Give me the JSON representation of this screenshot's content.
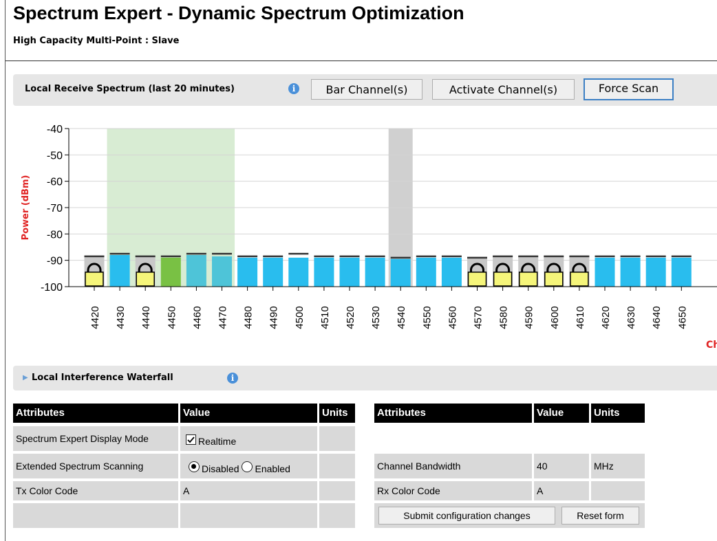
{
  "page": {
    "title": "Spectrum Expert - Dynamic Spectrum Optimization",
    "subtitle": "High Capacity Multi-Point : Slave"
  },
  "spectrum": {
    "title": "Local Receive Spectrum (last 20 minutes)",
    "info_icon": "i",
    "bar_button": "Bar Channel(s)",
    "activate_button": "Activate Channel(s)",
    "scan_button": "Force Scan",
    "axis_cut_label": "Ch"
  },
  "colors": {
    "available": "#29bdee",
    "active": "#79c144",
    "barred": "#f5f57a",
    "peak": "#c8c8c8",
    "active_band": "#d8ecd3",
    "scan_band": "#d0d0d0",
    "ylabel": "#e02424"
  },
  "chart_data": {
    "type": "bar",
    "ylabel": "Power (dBm)",
    "ylim": [
      -100,
      -40
    ],
    "yticks": [
      -40,
      -50,
      -60,
      -70,
      -80,
      -90,
      -100
    ],
    "grid": true,
    "categories": [
      "4420",
      "4430",
      "4440",
      "4450",
      "4460",
      "4470",
      "4480",
      "4490",
      "4500",
      "4510",
      "4520",
      "4530",
      "4540",
      "4550",
      "4560",
      "4570",
      "4580",
      "4590",
      "4600",
      "4610",
      "4620",
      "4630",
      "4640",
      "4650"
    ],
    "series": [
      {
        "values": [
          -94.5,
          -88,
          -94.5,
          -89,
          -88,
          -88.5,
          -89,
          -89,
          -89,
          -89,
          -89,
          -89,
          -89.5,
          -89,
          -89,
          -94.5,
          -94.5,
          -94.5,
          -94.5,
          -94.5,
          -89,
          -89,
          -89,
          -89
        ]
      }
    ],
    "peak": [
      -88.5,
      -87.5,
      -88.5,
      -88.5,
      -87.5,
      -87.5,
      -88.5,
      -88.5,
      -87.5,
      -88.5,
      -88.5,
      -88.5,
      -89,
      -88.5,
      -88.5,
      -89,
      -88.5,
      -88.5,
      -88.5,
      -88.5,
      -88.5,
      -88.5,
      -88.5,
      -88.5
    ],
    "state": [
      "barred",
      "available",
      "barred",
      "active",
      "active",
      "active",
      "available",
      "available",
      "available",
      "available",
      "available",
      "available",
      "available",
      "available",
      "available",
      "barred",
      "barred",
      "barred",
      "barred",
      "barred",
      "available",
      "available",
      "available",
      "available"
    ],
    "active_band": [
      "4430",
      "4470"
    ],
    "scan_band": [
      "4540"
    ]
  },
  "waterfall": {
    "title": "Local Interference Waterfall",
    "info_icon": "i",
    "arrow": "▶"
  },
  "left_table": {
    "headers": [
      "Attributes",
      "Value",
      "Units"
    ],
    "rows": [
      {
        "attr": "Spectrum Expert Display Mode",
        "value": "Realtime",
        "units": ""
      },
      {
        "attr": "Extended Spectrum Scanning",
        "opt1": "Disabled",
        "opt2": "Enabled",
        "units": ""
      },
      {
        "attr": "Tx Color Code",
        "value": "A",
        "units": ""
      },
      {
        "attr": "",
        "value": "",
        "units": ""
      }
    ]
  },
  "right_table": {
    "headers": [
      "Attributes",
      "Value",
      "Units"
    ],
    "rows": [
      {
        "attr": "Channel Bandwidth",
        "value": "40",
        "units": "MHz"
      },
      {
        "attr": "Rx Color Code",
        "value": "A",
        "units": ""
      }
    ],
    "submit_button": "Submit configuration changes",
    "reset_button": "Reset form"
  }
}
